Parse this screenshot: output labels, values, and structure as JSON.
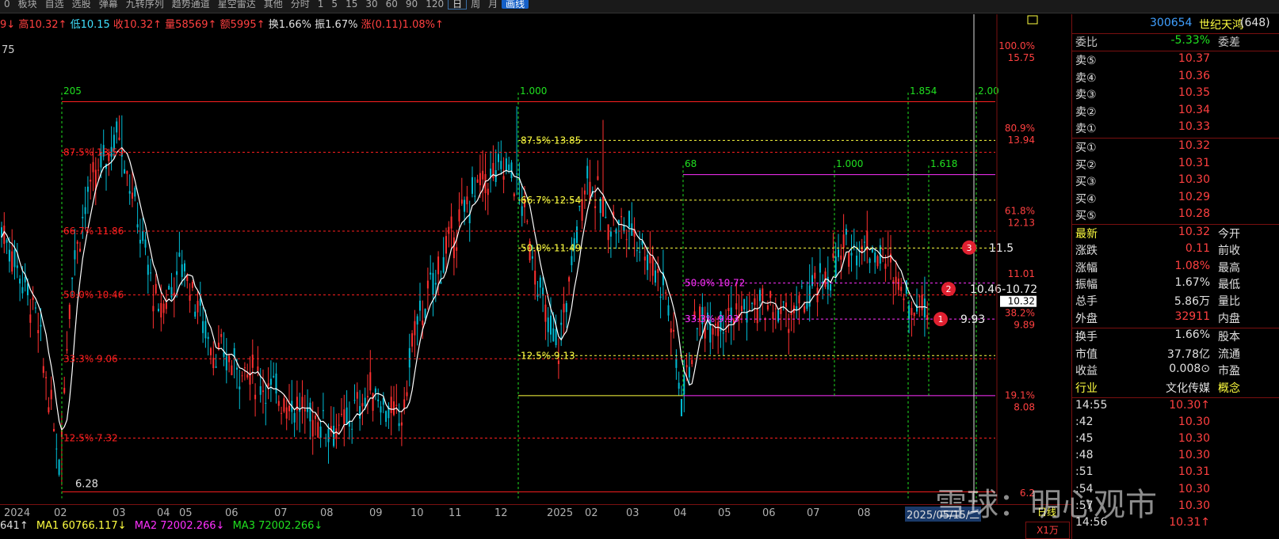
{
  "toolbar": {
    "items": [
      "0",
      "板块",
      "自选",
      "选股",
      "弹幕",
      "九转序列",
      "趋势通道",
      "星空雷达",
      "其他",
      "分时",
      "1",
      "5",
      "15",
      "30",
      "60",
      "90",
      "120",
      "日",
      "周",
      "月",
      "画线"
    ],
    "selected": "日"
  },
  "ohlc": {
    "prefix": "9↓",
    "high": "高10.32↑",
    "low": "低10.15",
    "close": "收10.32↑",
    "volume": "量58569↑",
    "amount": "额5995↑",
    "turnover": "换1.66%",
    "amplitude": "振1.67%",
    "change": "涨(0.11)1.08%↑"
  },
  "left_top_label": "75",
  "fib_groups": [
    {
      "start_label": "205",
      "end_label": "1.000"
    },
    {
      "start_label": "1.000",
      "mid_label": "1.854",
      "end_label": "2.00"
    },
    {
      "start_label": "68",
      "mid_label": "1.000",
      "end_label": "1.618"
    }
  ],
  "red_levels": [
    {
      "label": "87.5% 13.59",
      "price": 13.59
    },
    {
      "label": "66.7% 11.86",
      "price": 11.86
    },
    {
      "label": "50.0% 10.46",
      "price": 10.46
    },
    {
      "label": "33.3% 9.06",
      "price": 9.06
    },
    {
      "label": "12.5% 7.32",
      "price": 7.32
    }
  ],
  "yellow_levels": [
    {
      "label": "87.5% 13.85",
      "price": 13.85
    },
    {
      "label": "66.7% 12.54",
      "price": 12.54
    },
    {
      "label": "50.0% 11.49",
      "price": 11.49
    },
    {
      "label": "12.5% 9.13",
      "price": 9.13
    }
  ],
  "magenta_levels": [
    {
      "label": "50.0% 10.72",
      "price": 10.72
    },
    {
      "label": "33.3% 9.93",
      "price": 9.93
    }
  ],
  "low_label": "6.28",
  "markers": [
    {
      "num": "3",
      "text": "11.5"
    },
    {
      "num": "2",
      "text": "10.46-10.72"
    },
    {
      "num": "1",
      "text": "9.93"
    }
  ],
  "y_axis": [
    {
      "pct": "100.0%",
      "price": "15.75"
    },
    {
      "pct": "80.9%",
      "price": "13.94"
    },
    {
      "pct": "61.8%",
      "price": "12.13"
    },
    {
      "pct": "",
      "price": "11.01"
    },
    {
      "pct": "",
      "price": "10.32"
    },
    {
      "pct": "38.2%",
      "price": "9.89"
    },
    {
      "pct": "19.1%",
      "price": "8.08"
    },
    {
      "pct": "",
      "price": "6.2"
    }
  ],
  "x_axis": [
    "2024",
    "02",
    "03",
    "04",
    "05",
    "06",
    "07",
    "08",
    "09",
    "10",
    "11",
    "12",
    "2025",
    "02",
    "03",
    "04",
    "05",
    "06",
    "07",
    "08"
  ],
  "x_axis_current": "2025/05/15/二",
  "ma_line": {
    "prefix": "641↑",
    "ma1": "MA1 60766.117↓",
    "ma2": "MA2 72002.266↓",
    "ma3": "MA3 72002.266↓"
  },
  "right_panel": {
    "code": "300654",
    "name": "世纪天鸿",
    "count": "(648)",
    "weibi_label": "委比",
    "weibi_value": "-5.33%",
    "weicha_label": "委差",
    "sells": [
      {
        "label": "卖⑤",
        "price": "10.37"
      },
      {
        "label": "卖④",
        "price": "10.36"
      },
      {
        "label": "卖③",
        "price": "10.35"
      },
      {
        "label": "卖②",
        "price": "10.34"
      },
      {
        "label": "卖①",
        "price": "10.33"
      }
    ],
    "buys": [
      {
        "label": "买①",
        "price": "10.32"
      },
      {
        "label": "买②",
        "price": "10.31"
      },
      {
        "label": "买③",
        "price": "10.30"
      },
      {
        "label": "买④",
        "price": "10.29"
      },
      {
        "label": "买⑤",
        "price": "10.28"
      }
    ],
    "quote": [
      {
        "l1": "最新",
        "v": "10.32",
        "l2": "今开",
        "c": "#ff4040"
      },
      {
        "l1": "涨跌",
        "v": "0.11",
        "l2": "前收",
        "c": "#ff4040"
      },
      {
        "l1": "涨幅",
        "v": "1.08%",
        "l2": "最高",
        "c": "#ff4040"
      },
      {
        "l1": "振幅",
        "v": "1.67%",
        "l2": "最低",
        "c": "#e0e0e0"
      },
      {
        "l1": "总手",
        "v": "5.86万",
        "l2": "量比",
        "c": "#e0e0e0"
      },
      {
        "l1": "外盘",
        "v": "32911",
        "l2": "内盘",
        "c": "#ff4040"
      }
    ],
    "info": [
      {
        "l1": "换手",
        "v": "1.66%",
        "l2": "股本"
      },
      {
        "l1": "市值",
        "v": "37.78亿",
        "l2": "流通"
      },
      {
        "l1": "收益",
        "v": "0.008⊙",
        "l2": "市盈"
      },
      {
        "l1": "行业",
        "v": "文化传媒",
        "l2": "概念"
      }
    ],
    "ticks": [
      {
        "time": "14:55",
        "price": "10.30↑"
      },
      {
        "time": ":42",
        "price": "10.30"
      },
      {
        "time": ":45",
        "price": "10.30"
      },
      {
        "time": ":48",
        "price": "10.30"
      },
      {
        "time": ":51",
        "price": "10.31"
      },
      {
        "time": ":54",
        "price": "10.30"
      },
      {
        "time": ":57",
        "price": "10.30"
      },
      {
        "time": "14:56",
        "price": "10.31↑"
      }
    ]
  },
  "bottom_tabs": [
    "日线",
    "X1万"
  ],
  "watermark": "雪球：明心观市",
  "colors": {
    "up": "#ff3030",
    "down": "#00bcd4",
    "ma": "#ffffff",
    "fib_red": "#ff2020",
    "fib_yellow": "#ffff40",
    "fib_magenta": "#ff30ff",
    "fib_green": "#20e020"
  }
}
